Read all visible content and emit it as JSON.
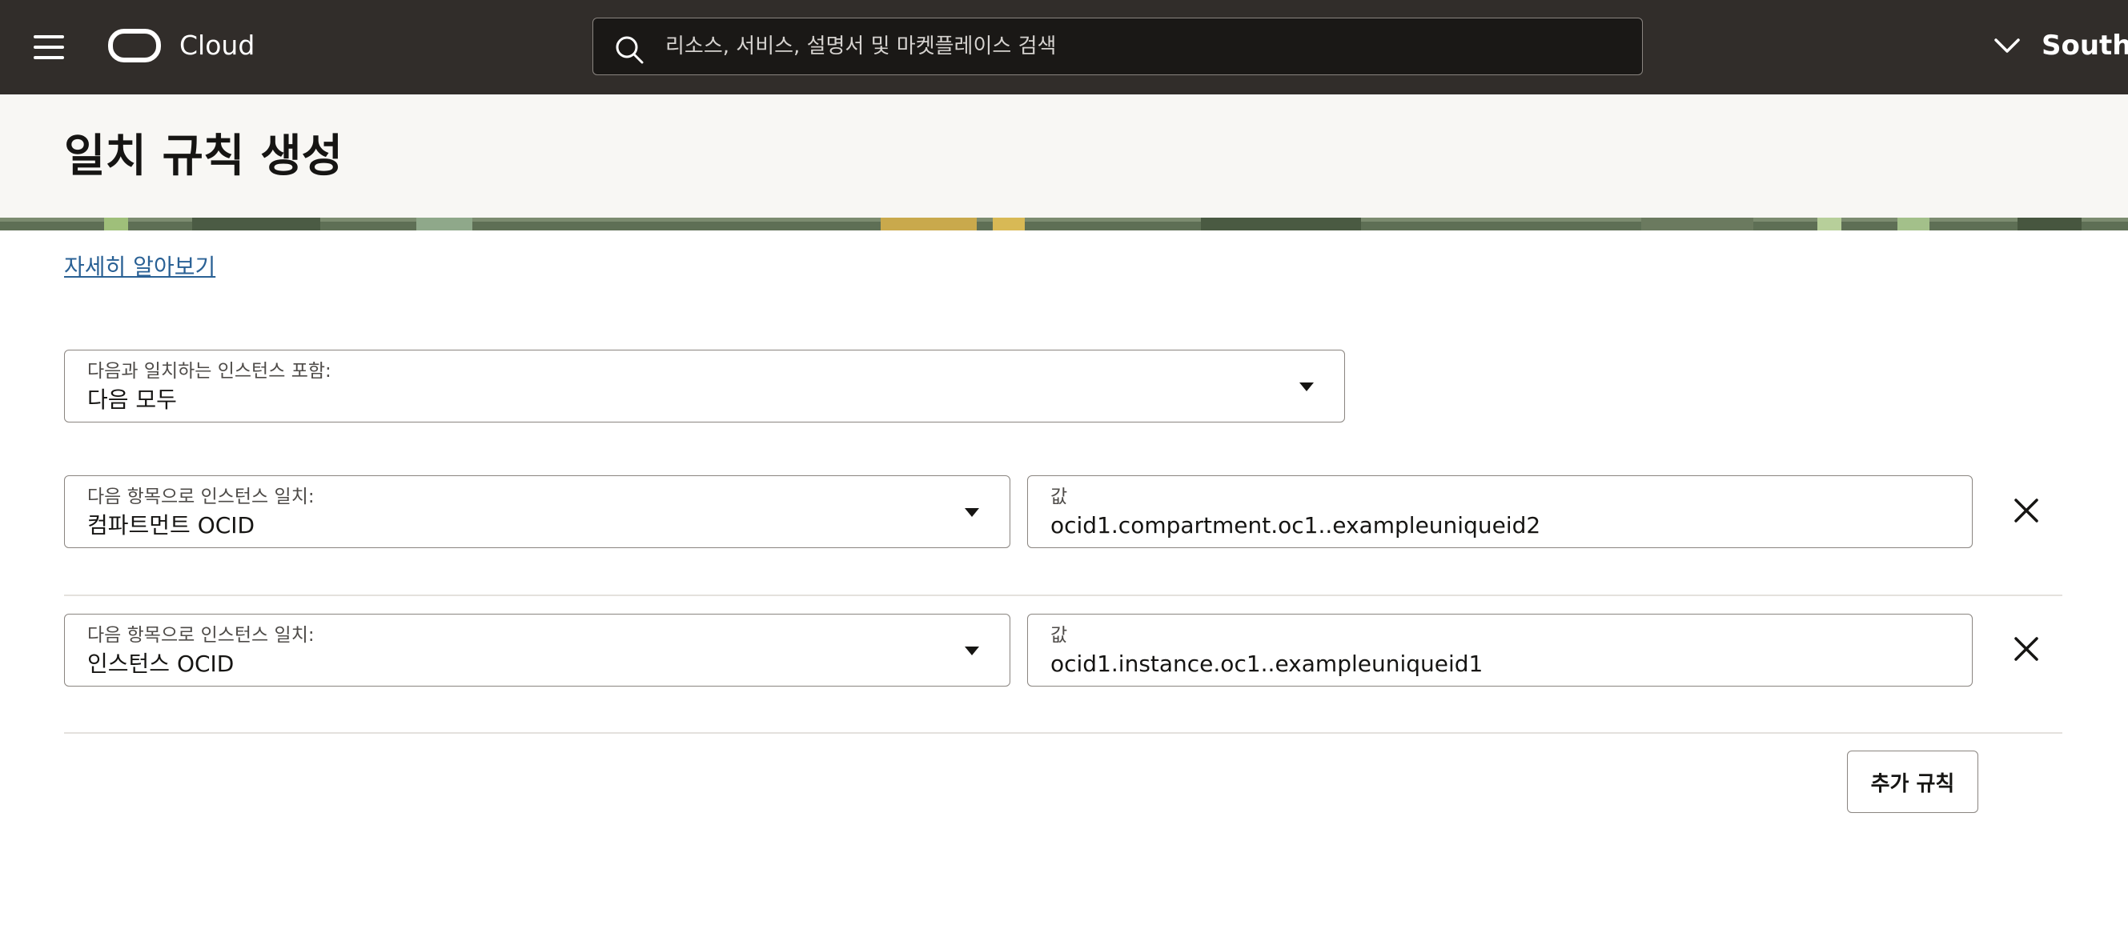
{
  "topbar": {
    "brand": "Cloud",
    "search_placeholder": "리소스, 서비스, 설명서 및 마켓플레이스 검색",
    "region": "South Korea Central (Seoul)"
  },
  "page": {
    "title": "일치 규칙 생성",
    "learn_more": "자세히 알아보기"
  },
  "include_select": {
    "label": "다음과 일치하는 인스턴스 포함:",
    "value": "다음 모두"
  },
  "rules": [
    {
      "match_label": "다음 항목으로 인스턴스 일치:",
      "match_value": "컴파트먼트 OCID",
      "value_label": "값",
      "value": "ocid1.compartment.oc1..exampleuniqueid2"
    },
    {
      "match_label": "다음 항목으로 인스턴스 일치:",
      "match_value": "인스턴스 OCID",
      "value_label": "값",
      "value": "ocid1.instance.oc1..exampleuniqueid1"
    }
  ],
  "add_rule_label": "추가 규칙",
  "colors": {
    "topbar": "#312d2a",
    "header_bg": "#f8f7f4",
    "link": "#2a6195",
    "border": "#8a8580"
  }
}
